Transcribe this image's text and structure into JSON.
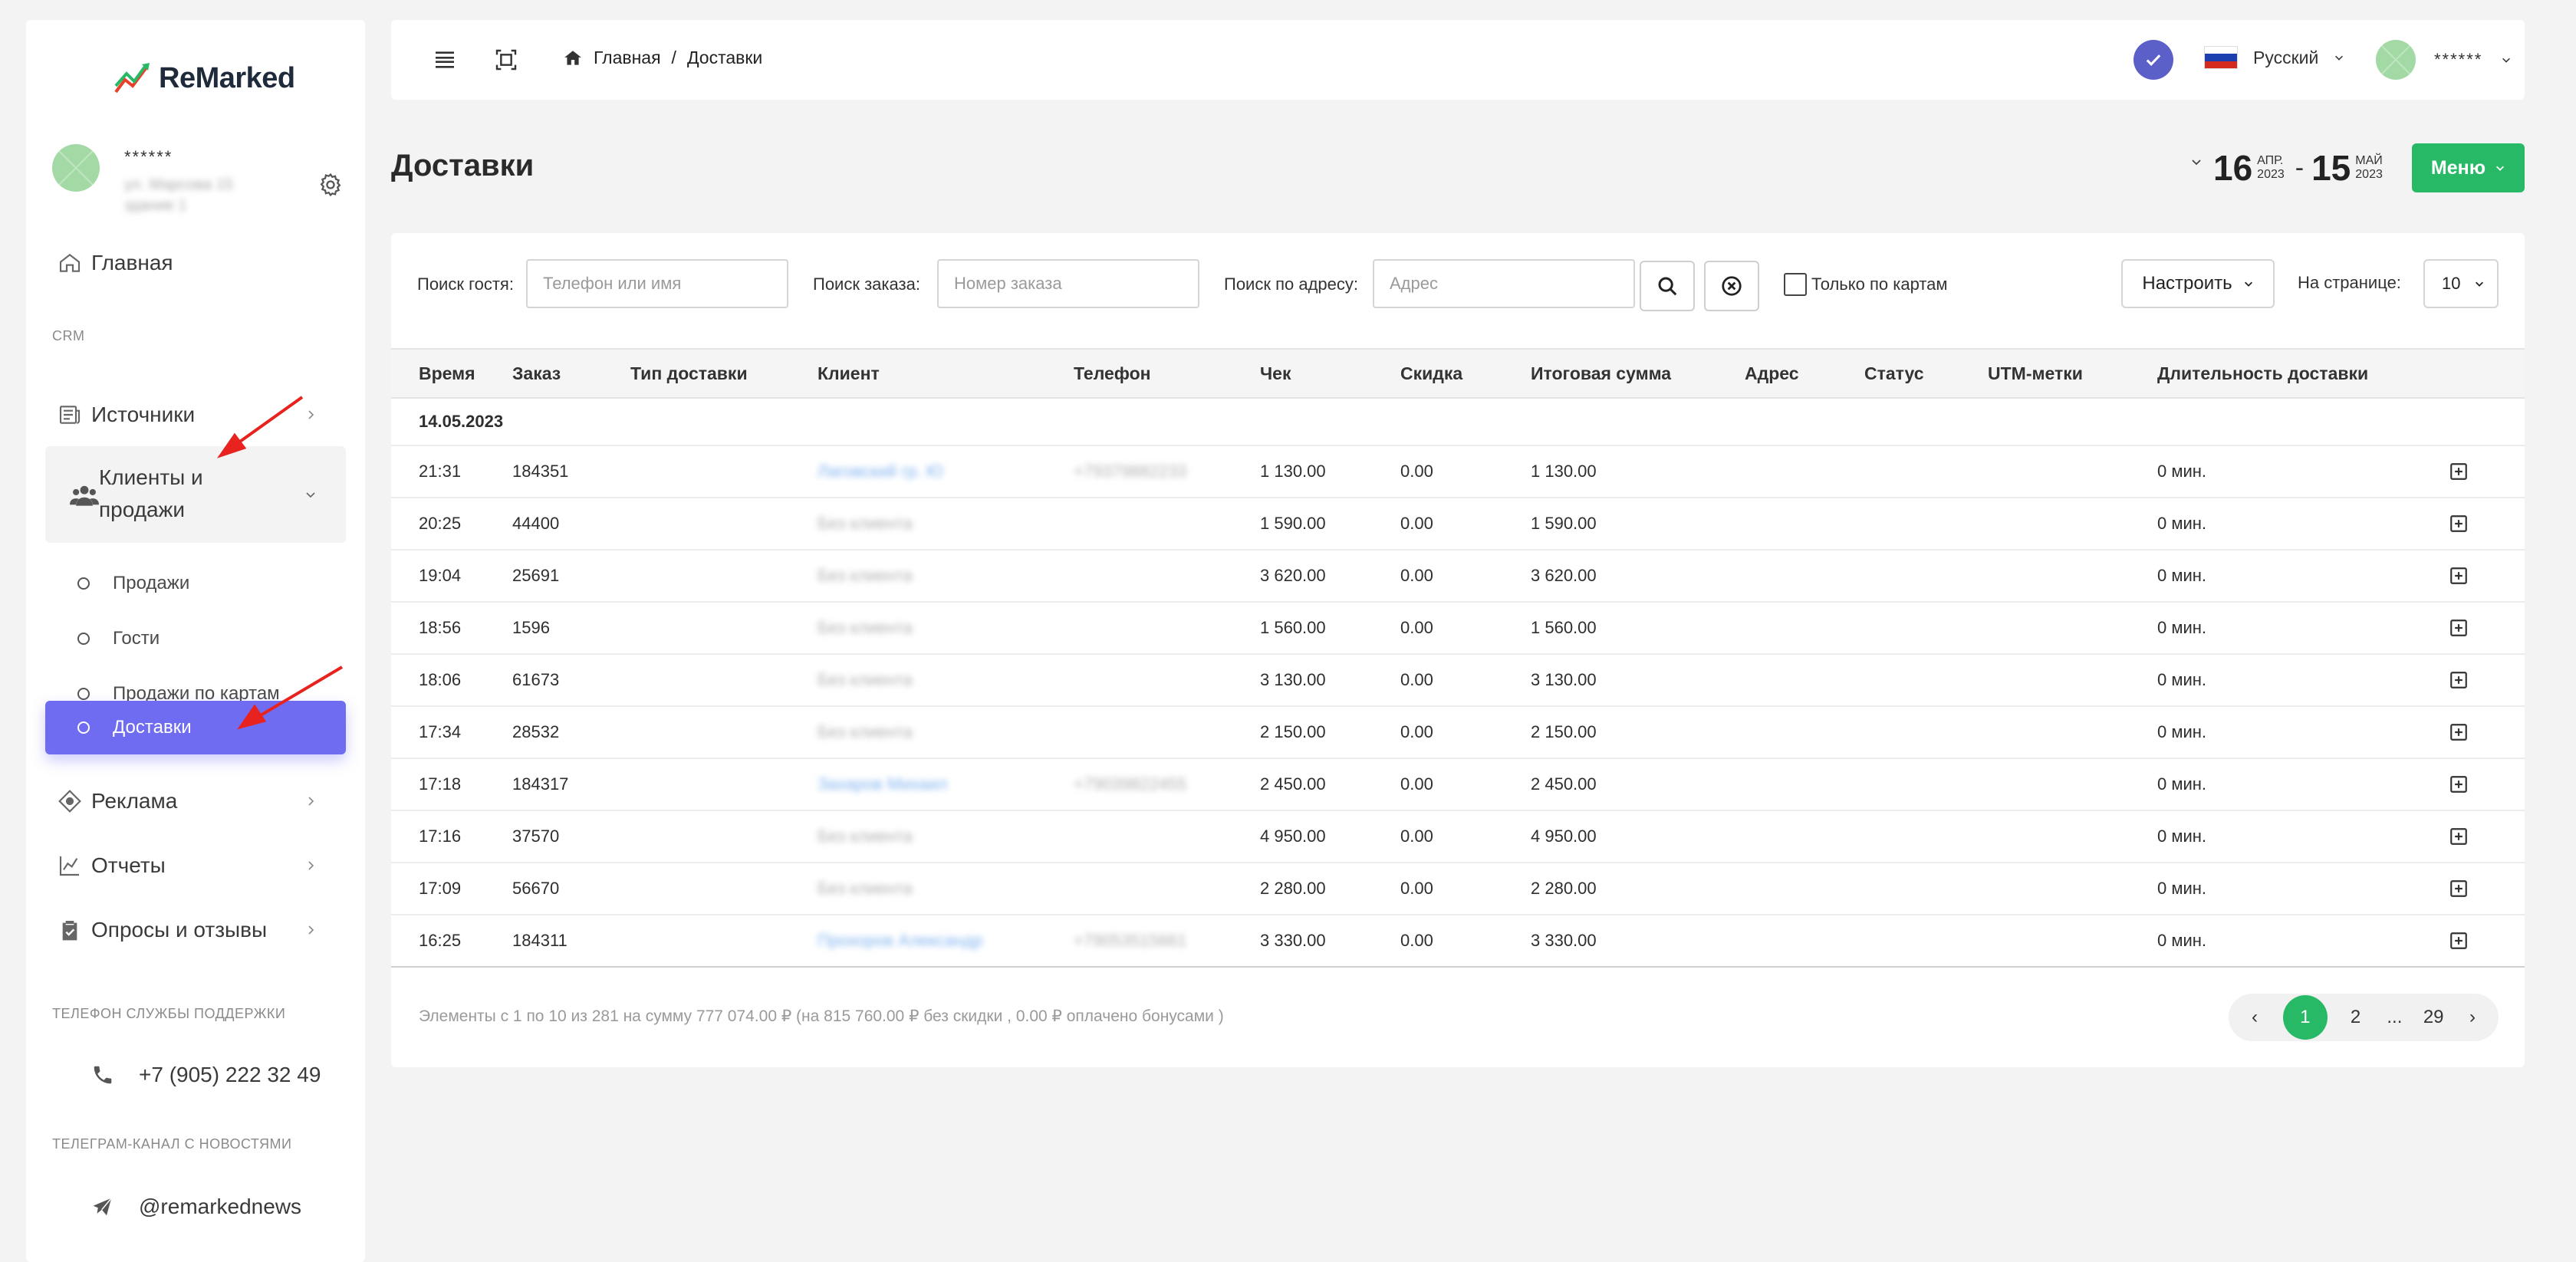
{
  "sidebar": {
    "logo_text": "ReMarked",
    "profile": {
      "name": "******",
      "sub": "ул. Марсова 15 здание 1"
    },
    "nav_home": "Главная",
    "section_crm": "CRM",
    "nav_sources": "Источники",
    "nav_clients": "Клиенты и продажи",
    "sub_items": [
      "Продажи",
      "Гости",
      "Продажи по картам",
      "Доставки"
    ],
    "nav_ads": "Реклама",
    "nav_reports": "Отчеты",
    "nav_surveys": "Опросы и отзывы",
    "support_label": "ТЕЛЕФОН СЛУЖБЫ ПОДДЕРЖКИ",
    "support_phone": "+7 (905) 222 32 49",
    "telegram_label": "ТЕЛЕГРАМ-КАНАЛ С НОВОСТЯМИ",
    "telegram_handle": "@remarkednews"
  },
  "topbar": {
    "breadcrumb_home": "Главная",
    "breadcrumb_sep": "/",
    "breadcrumb_current": "Доставки",
    "language": "Русский",
    "user": "******"
  },
  "page": {
    "title": "Доставки",
    "date_from_day": "16",
    "date_from_month": "АПР.",
    "date_from_year": "2023",
    "date_sep": "-",
    "date_to_day": "15",
    "date_to_month": "МАЙ",
    "date_to_year": "2023",
    "menu_label": "Меню"
  },
  "filters": {
    "guest_label": "Поиск гостя:",
    "guest_placeholder": "Телефон или имя",
    "order_label": "Поиск заказа:",
    "order_placeholder": "Номер заказа",
    "address_label": "Поиск по адресу:",
    "address_placeholder": "Адрес",
    "cards_only": "Только по картам",
    "configure": "Настроить",
    "per_page_label": "На странице:",
    "per_page_value": "10"
  },
  "table": {
    "headers": [
      "Время",
      "Заказ",
      "Тип доставки",
      "Клиент",
      "Телефон",
      "Чек",
      "Скидка",
      "Итоговая сумма",
      "Адрес",
      "Статус",
      "UTM-метки",
      "Длительность доставки"
    ],
    "date_group": "14.05.2023",
    "rows": [
      {
        "time": "21:31",
        "order": "184351",
        "client": "Лаговский гр. Ю",
        "client_link": true,
        "phone": "+79379882233",
        "check": "1 130.00",
        "discount": "0.00",
        "total": "1 130.00",
        "duration": "0 мин."
      },
      {
        "time": "20:25",
        "order": "44400",
        "client": "Без клиента",
        "client_link": false,
        "phone": "",
        "check": "1 590.00",
        "discount": "0.00",
        "total": "1 590.00",
        "duration": "0 мин."
      },
      {
        "time": "19:04",
        "order": "25691",
        "client": "Без клиента",
        "client_link": false,
        "phone": "",
        "check": "3 620.00",
        "discount": "0.00",
        "total": "3 620.00",
        "duration": "0 мин."
      },
      {
        "time": "18:56",
        "order": "1596",
        "client": "Без клиента",
        "client_link": false,
        "phone": "",
        "check": "1 560.00",
        "discount": "0.00",
        "total": "1 560.00",
        "duration": "0 мин."
      },
      {
        "time": "18:06",
        "order": "61673",
        "client": "Без клиента",
        "client_link": false,
        "phone": "",
        "check": "3 130.00",
        "discount": "0.00",
        "total": "3 130.00",
        "duration": "0 мин."
      },
      {
        "time": "17:34",
        "order": "28532",
        "client": "Без клиента",
        "client_link": false,
        "phone": "",
        "check": "2 150.00",
        "discount": "0.00",
        "total": "2 150.00",
        "duration": "0 мин."
      },
      {
        "time": "17:18",
        "order": "184317",
        "client": "Захаров Михаил",
        "client_link": true,
        "phone": "+79039822455",
        "check": "2 450.00",
        "discount": "0.00",
        "total": "2 450.00",
        "duration": "0 мин."
      },
      {
        "time": "17:16",
        "order": "37570",
        "client": "Без клиента",
        "client_link": false,
        "phone": "",
        "check": "4 950.00",
        "discount": "0.00",
        "total": "4 950.00",
        "duration": "0 мин."
      },
      {
        "time": "17:09",
        "order": "56670",
        "client": "Без клиента",
        "client_link": false,
        "phone": "",
        "check": "2 280.00",
        "discount": "0.00",
        "total": "2 280.00",
        "duration": "0 мин."
      },
      {
        "time": "16:25",
        "order": "184311",
        "client": "Прохоров Александр",
        "client_link": true,
        "phone": "+79053515661",
        "check": "3 330.00",
        "discount": "0.00",
        "total": "3 330.00",
        "duration": "0 мин."
      }
    ]
  },
  "footer": {
    "summary": "Элементы с 1 по 10 из 281 на сумму 777 074.00 ₽ (на 815 760.00 ₽ без скидки , 0.00 ₽ оплачено бонусами )",
    "pages": [
      "1",
      "2",
      "...",
      "29"
    ],
    "prev": "‹",
    "next": "›"
  },
  "colors": {
    "accent": "#6f6cf2",
    "green": "#28b967",
    "badge": "#5a60c8",
    "annotation": "#e8231f"
  }
}
